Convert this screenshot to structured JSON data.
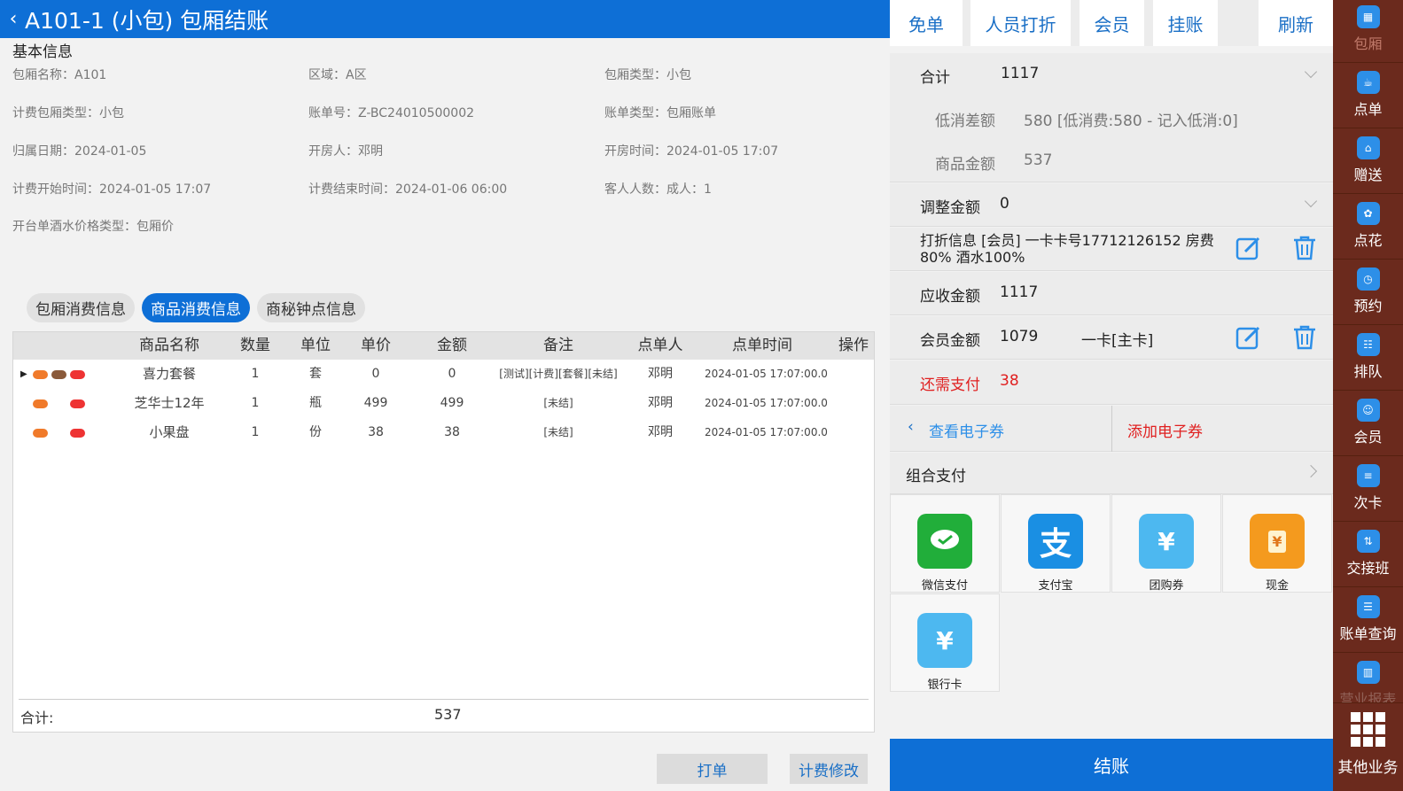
{
  "header": {
    "title": "A101-1 (小包) 包厢结账"
  },
  "basic": {
    "title": "基本信息",
    "fields": [
      "包厢名称：A101",
      "区域：A区",
      "包厢类型：小包",
      "计费包厢类型：小包",
      "账单号：Z-BC24010500002",
      "账单类型：包厢账单",
      "归属日期：2024-01-05",
      "开房人：邓明",
      "开房时间：2024-01-05 17:07",
      "计费开始时间：2024-01-05 17:07",
      "计费结束时间：2024-01-06 06:00",
      "客人人数：成人：1",
      "开台单酒水价格类型：包厢价"
    ]
  },
  "tabs": [
    "包厢消费信息",
    "商品消费信息",
    "商秘钟点信息"
  ],
  "table": {
    "headers": [
      "商品名称",
      "数量",
      "单位",
      "单价",
      "金额",
      "备注",
      "点单人",
      "点单时间",
      "操作"
    ],
    "rows": [
      {
        "name": "喜力套餐",
        "qty": "1",
        "unit": "套",
        "price": "0",
        "amount": "0",
        "note": "[测试][计费][套餐][未结]",
        "by": "邓明",
        "time": "2024-01-05 17:07:00.0"
      },
      {
        "name": "芝华士12年",
        "qty": "1",
        "unit": "瓶",
        "price": "499",
        "amount": "499",
        "note": "[未结]",
        "by": "邓明",
        "time": "2024-01-05 17:07:00.0"
      },
      {
        "name": "小果盘",
        "qty": "1",
        "unit": "份",
        "price": "38",
        "amount": "38",
        "note": "[未结]",
        "by": "邓明",
        "time": "2024-01-05 17:07:00.0"
      }
    ],
    "total_label": "合计:",
    "total_value": "537"
  },
  "left_buttons": {
    "print": "打单",
    "modify": "计费修改"
  },
  "right": {
    "top_buttons": [
      "免单",
      "人员打折",
      "会员",
      "挂账",
      "刷新"
    ],
    "total_label": "合计",
    "total_value": "1117",
    "min_label": "低消差额",
    "min_value": "580 [低消费:580 - 记入低消:0]",
    "goods_label": "商品金额",
    "goods_value": "537",
    "adjust_label": "调整金额",
    "adjust_value": "0",
    "discount_text": "打折信息 [会员] 一卡卡号17712126152 房费80% 酒水100%",
    "receivable_label": "应收金额",
    "receivable_value": "1117",
    "member_label": "会员金额",
    "member_value": "1079",
    "member_card": "一卡[主卡]",
    "due_label": "还需支付",
    "due_value": "38",
    "coupon_view": "查看电子券",
    "coupon_add": "添加电子券",
    "combo_label": "组合支付",
    "payments": [
      "微信支付",
      "支付宝",
      "团购券",
      "现金",
      "银行卡"
    ],
    "checkout": "结账"
  },
  "sidebar": {
    "items": [
      "包厢",
      "点单",
      "赠送",
      "点花",
      "预约",
      "排队",
      "会员",
      "次卡",
      "交接班",
      "账单查询",
      "营业报表"
    ],
    "other": "其他业务"
  },
  "colors": {
    "primary": "#0e6fd6",
    "sidebar": "#6b2a1d",
    "due": "#e02020"
  }
}
